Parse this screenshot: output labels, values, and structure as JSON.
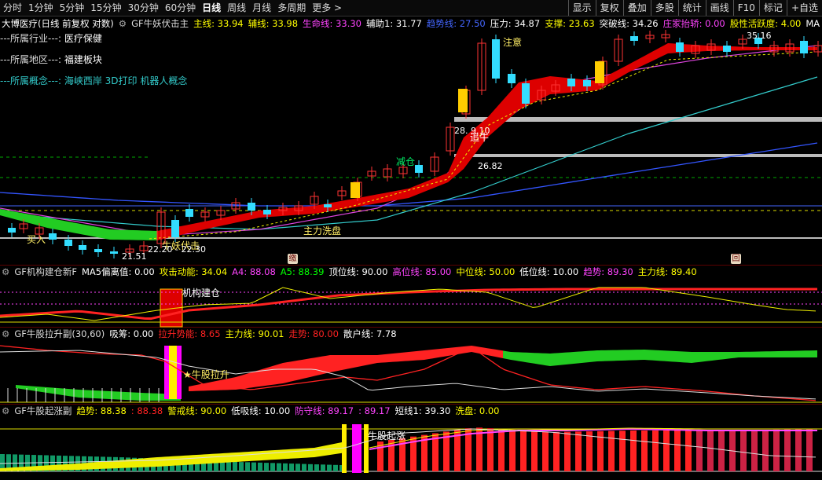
{
  "toolbar": {
    "periods": [
      "分时",
      "1分钟",
      "5分钟",
      "15分钟",
      "30分钟",
      "60分钟",
      "日线",
      "周线",
      "月线",
      "多周期",
      "更多 >"
    ],
    "active_period": "日线",
    "right_buttons": [
      "显示",
      "复权",
      "叠加",
      "多股",
      "统计",
      "画线",
      "F10",
      "标记",
      "+自选"
    ]
  },
  "main": {
    "title": "大博医疗(日线 前复权 对数)",
    "indicator_name": "GF牛妖伏击主",
    "legend": [
      {
        "label": "主线: 33.94",
        "color": "#ffff00"
      },
      {
        "label": "辅线: 33.98",
        "color": "#ffff00"
      },
      {
        "label": "生命线: 33.30",
        "color": "#ff44ff"
      },
      {
        "label": "辅助1: 31.77",
        "color": "#ffffff"
      },
      {
        "label": "趋势线: 27.50",
        "color": "#4466ff"
      },
      {
        "label": "压力: 34.87",
        "color": "#ffffff"
      },
      {
        "label": "支撑: 23.63",
        "color": "#ffff00"
      },
      {
        "label": "突破线: 34.26",
        "color": "#ffffff"
      },
      {
        "label": "庄家抬轿: 0.00",
        "color": "#ff44ff"
      },
      {
        "label": "股性活跃度: 4.00",
        "color": "#ffff00"
      },
      {
        "label": "MA",
        "color": "#ffffff"
      }
    ],
    "info_lines": [
      {
        "key": "---所属行业---:",
        "value": "医疗保健",
        "color": "#ffffff"
      },
      {
        "key": "---所属地区---:",
        "value": "福建板块",
        "color": "#ffffff"
      },
      {
        "key": "---所属概念---:",
        "value": "海峡西岸 3D打印 机器人概念",
        "color": "#33cccc"
      }
    ],
    "annotations": {
      "attention": "注意",
      "chase_bull": "追牛",
      "reduce": "减仓",
      "main_wash": "主力洗盘",
      "buy": "买入",
      "ambush": "牛妖伏击",
      "low_price": "21.51",
      "range_low": "22.20 - 22.30",
      "level_2682": "26.82",
      "level_2910": "28.   9.10",
      "high_price": "35.16",
      "badge1": "缴",
      "badge2": "回"
    }
  },
  "panel2": {
    "indicator_name": "GF机构建仓新F",
    "legend": [
      {
        "label": "MA5偏离值: 0.00",
        "color": "#ffffff"
      },
      {
        "label": "攻击动能: 34.04",
        "color": "#ffff00"
      },
      {
        "label": "A4: 88.08",
        "color": "#ff44ff"
      },
      {
        "label": "A5: 88.39",
        "color": "#00ff00"
      },
      {
        "label": "顶位线: 90.00",
        "color": "#ffffff"
      },
      {
        "label": "高位线: 85.00",
        "color": "#ff44ff"
      },
      {
        "label": "中位线: 50.00",
        "color": "#ffff00"
      },
      {
        "label": "低位线: 10.00",
        "color": "#ffffff"
      },
      {
        "label": "趋势: 89.30",
        "color": "#ff44ff"
      },
      {
        "label": "主力线: 89.40",
        "color": "#ffff00"
      }
    ],
    "annotation": "机构建仓"
  },
  "panel3": {
    "indicator_name": "GF牛股拉升副(30,60)",
    "legend": [
      {
        "label": "吸筹: 0.00",
        "color": "#ffffff"
      },
      {
        "label": "拉升势能: 8.65",
        "color": "#ff2222"
      },
      {
        "label": "主力线: 90.01",
        "color": "#ffff00"
      },
      {
        "label": "走势: 80.00",
        "color": "#ff2222"
      },
      {
        "label": "散户线: 7.78",
        "color": "#ffffff"
      }
    ],
    "annotation": "★牛股拉升"
  },
  "panel4": {
    "indicator_name": "GF牛股起涨副",
    "legend": [
      {
        "label": "趋势: 88.38",
        "color": "#ffff00"
      },
      {
        "label": ": 88.38",
        "color": "#ff2222"
      },
      {
        "label": "警戒线: 90.00",
        "color": "#ffff00"
      },
      {
        "label": "低吸线: 10.00",
        "color": "#ffffff"
      },
      {
        "label": "防守线: 89.17",
        "color": "#ff44ff"
      },
      {
        "label": ": 89.17",
        "color": "#ff44ff"
      },
      {
        "label": "短线1: 39.30",
        "color": "#ffffff"
      },
      {
        "label": "洗盘: 0.00",
        "color": "#ffff00"
      }
    ],
    "annotation": "牛股起涨"
  },
  "colors": {
    "up": "#ff3333",
    "down": "#33ddff",
    "ribbon_up": "#dd0000",
    "ribbon_down": "#22cc22",
    "separator": "#5a0000"
  }
}
